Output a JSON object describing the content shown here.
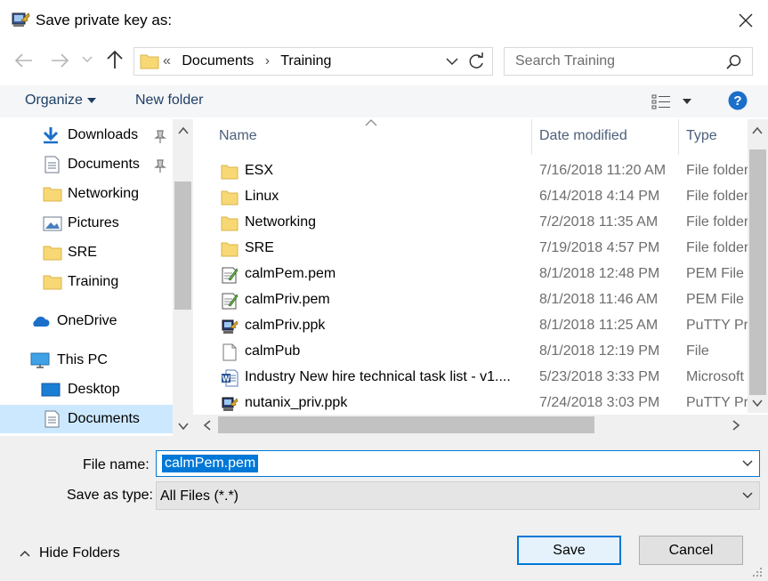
{
  "window": {
    "title": "Save private key as:"
  },
  "address": {
    "prefix": "«",
    "crumbs": [
      "Documents",
      "Training"
    ],
    "separator": "›"
  },
  "search": {
    "placeholder": "Search Training"
  },
  "toolbar": {
    "organize": "Organize",
    "new_folder": "New folder"
  },
  "nav": {
    "items": [
      {
        "label": "Downloads",
        "icon": "download-arrow-icon",
        "pinned": true
      },
      {
        "label": "Documents",
        "icon": "document-icon",
        "pinned": true
      },
      {
        "label": "Networking",
        "icon": "folder-icon",
        "pinned": false
      },
      {
        "label": "Pictures",
        "icon": "pictures-icon",
        "pinned": false
      },
      {
        "label": "SRE",
        "icon": "folder-icon",
        "pinned": false
      },
      {
        "label": "Training",
        "icon": "folder-icon",
        "pinned": false
      },
      {
        "label": "OneDrive",
        "icon": "cloud-icon",
        "pinned": false
      },
      {
        "label": "This PC",
        "icon": "computer-icon",
        "pinned": false
      },
      {
        "label": "Desktop",
        "icon": "desktop-icon",
        "pinned": false
      },
      {
        "label": "Documents",
        "icon": "document-icon",
        "pinned": false,
        "selected": true
      }
    ]
  },
  "columns": {
    "name": "Name",
    "date": "Date modified",
    "type": "Type"
  },
  "files": [
    {
      "name": "ESX",
      "date": "7/16/2018 11:20 AM",
      "type": "File folder",
      "icon": "folder-icon"
    },
    {
      "name": "Linux",
      "date": "6/14/2018 4:14 PM",
      "type": "File folder",
      "icon": "folder-icon"
    },
    {
      "name": "Networking",
      "date": "7/2/2018 11:35 AM",
      "type": "File folder",
      "icon": "folder-icon"
    },
    {
      "name": "SRE",
      "date": "7/19/2018 4:57 PM",
      "type": "File folder",
      "icon": "folder-icon"
    },
    {
      "name": "calmPem.pem",
      "date": "8/1/2018 12:48 PM",
      "type": "PEM File",
      "icon": "pem-file-icon"
    },
    {
      "name": "calmPriv.pem",
      "date": "8/1/2018 11:46 AM",
      "type": "PEM File",
      "icon": "pem-file-icon"
    },
    {
      "name": "calmPriv.ppk",
      "date": "8/1/2018 11:25 AM",
      "type": "PuTTY Private Key File",
      "icon": "putty-key-icon"
    },
    {
      "name": "calmPub",
      "date": "8/1/2018 12:19 PM",
      "type": "File",
      "icon": "blank-file-icon"
    },
    {
      "name": "Industry New hire technical task list - v1....",
      "date": "5/23/2018 3:33 PM",
      "type": "Microsoft Word Document",
      "icon": "word-doc-icon"
    },
    {
      "name": "nutanix_priv.ppk",
      "date": "7/24/2018 3:03 PM",
      "type": "PuTTY Private Key File",
      "icon": "putty-key-icon"
    }
  ],
  "form": {
    "filename_label": "File name:",
    "filename_value": "calmPem.pem",
    "type_label": "Save as type:",
    "type_value": "All Files (*.*)"
  },
  "footer": {
    "hide_folders": "Hide Folders",
    "save": "Save",
    "cancel": "Cancel"
  },
  "colors": {
    "accent": "#0078d7",
    "selection": "#cce8ff",
    "link": "#1e3f66",
    "folder": "#f8d775"
  }
}
